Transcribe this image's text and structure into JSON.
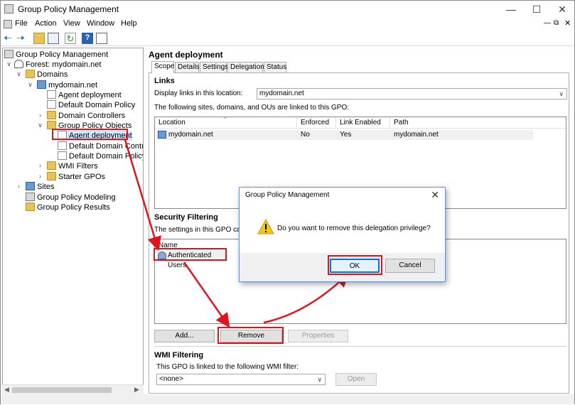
{
  "window": {
    "title": "Group Policy Management"
  },
  "menu": {
    "items": [
      "File",
      "Action",
      "View",
      "Window",
      "Help"
    ]
  },
  "tree": {
    "root": "Group Policy Management",
    "forest": "Forest: mydomain.net",
    "domains": "Domains",
    "domain": "mydomain.net",
    "gpo_link1": "Agent deployment",
    "gpo_link2": "Default Domain Policy",
    "domain_controllers": "Domain Controllers",
    "gpo_objects": "Group Policy Objects",
    "gpo_obj1": "Agent deployment",
    "gpo_obj2": "Default Domain Controlle",
    "gpo_obj3": "Default Domain Policy",
    "wmi_filters": "WMI Filters",
    "starter_gpos": "Starter GPOs",
    "sites": "Sites",
    "modeling": "Group Policy Modeling",
    "results": "Group Policy Results"
  },
  "details": {
    "title": "Agent deployment",
    "tabs": [
      "Scope",
      "Details",
      "Settings",
      "Delegation",
      "Status"
    ],
    "links": {
      "title": "Links",
      "display_label": "Display links in this location:",
      "location_value": "mydomain.net",
      "description": "The following sites, domains, and OUs are linked to this GPO:",
      "columns": [
        "Location",
        "Enforced",
        "Link Enabled",
        "Path"
      ],
      "row": {
        "location": "mydomain.net",
        "enforced": "No",
        "link_enabled": "Yes",
        "path": "mydomain.net"
      }
    },
    "security": {
      "title": "Security Filtering",
      "description": "The settings in this GPO can on",
      "column": "Name",
      "row": "Authenticated Users",
      "add_label": "Add...",
      "remove_label": "Remove",
      "properties_label": "Properties"
    },
    "wmi": {
      "title": "WMI Filtering",
      "description": "This GPO is linked to the following WMI filter:",
      "value": "<none>",
      "open_label": "Open"
    }
  },
  "dialog": {
    "title": "Group Policy Management",
    "message": "Do you want to remove this delegation privilege?",
    "ok_label": "OK",
    "cancel_label": "Cancel"
  },
  "colors": {
    "highlight": "#e0141c",
    "accent": "#0078d7"
  }
}
